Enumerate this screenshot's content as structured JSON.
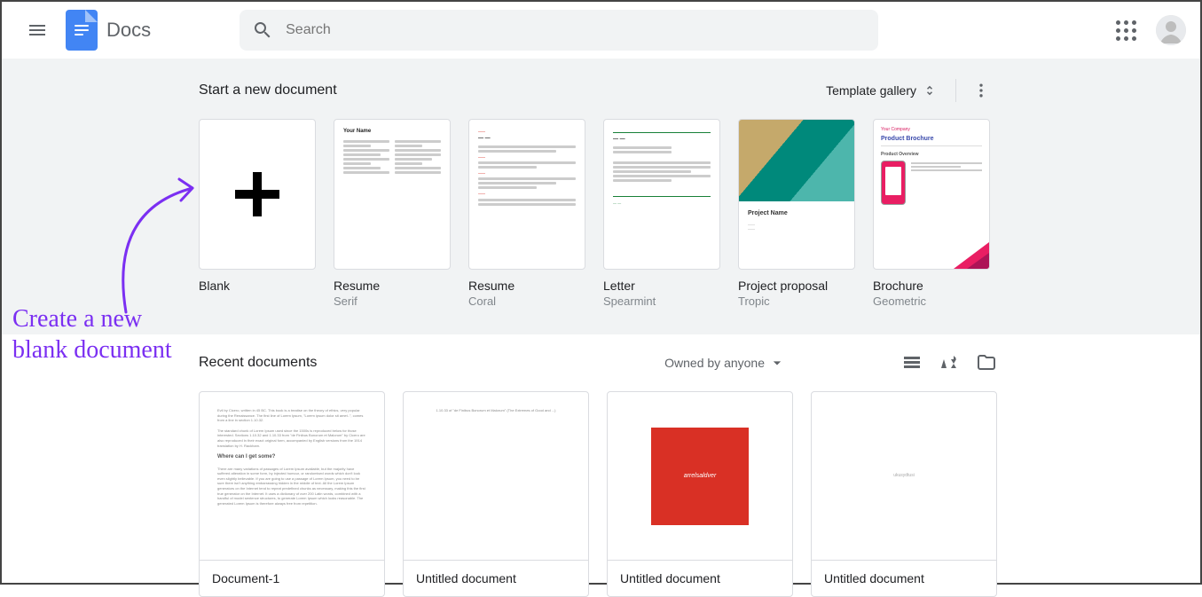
{
  "header": {
    "app_title": "Docs",
    "search_placeholder": "Search"
  },
  "templates": {
    "section_title": "Start a new document",
    "gallery_label": "Template gallery",
    "cards": [
      {
        "label": "Blank",
        "sub": ""
      },
      {
        "label": "Resume",
        "sub": "Serif"
      },
      {
        "label": "Resume",
        "sub": "Coral"
      },
      {
        "label": "Letter",
        "sub": "Spearmint"
      },
      {
        "label": "Project proposal",
        "sub": "Tropic"
      },
      {
        "label": "Brochure",
        "sub": "Geometric"
      }
    ],
    "preview": {
      "resume_serif_heading": "Your Name",
      "proposal_title": "Project Name",
      "brochure_company": "Your Company",
      "brochure_title": "Product Brochure",
      "brochure_overview": "Product Overview"
    }
  },
  "recent": {
    "section_title": "Recent documents",
    "filter_label": "Owned by anyone",
    "docs": [
      {
        "title": "Document-1"
      },
      {
        "title": "Untitled document"
      },
      {
        "title": "Untitled document"
      },
      {
        "title": "Untitled document"
      }
    ],
    "preview": {
      "doc1_heading": "Where can I get some?",
      "doc3_box": "arrelsaldver",
      "doc4_text": "ukusydtusi"
    }
  },
  "annotation": {
    "text_line1": "Create a new",
    "text_line2": "blank document"
  }
}
